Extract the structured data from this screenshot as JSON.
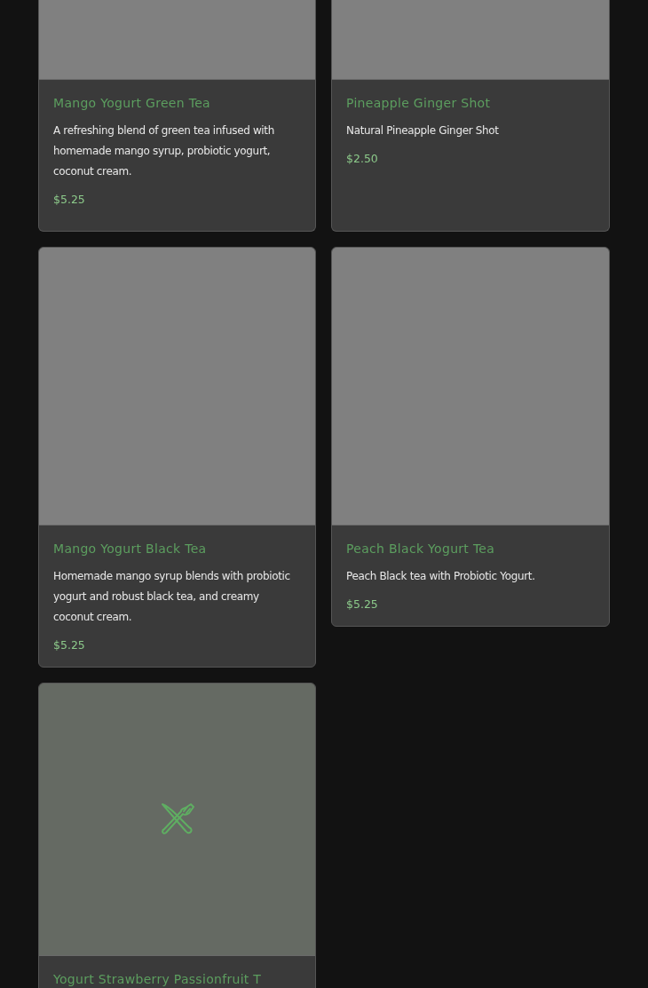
{
  "products": [
    {
      "kind": "photo",
      "name": "Mango Yogurt Green Tea",
      "description": "A refreshing blend of green tea infused with homemade mango syrup, probiotic yogurt, coconut cream.",
      "price": "$5.25"
    },
    {
      "kind": "photo",
      "name": "Pineapple Ginger Shot",
      "description": "Natural Pineapple Ginger Shot",
      "price": "$2.50"
    },
    {
      "kind": "photo",
      "name": "Mango Yogurt Black Tea",
      "description": "Homemade mango syrup blends with probiotic yogurt and robust black tea, and creamy coconut cream.",
      "price": "$5.25"
    },
    {
      "kind": "photo",
      "name": "Peach Black Yogurt Tea",
      "description": "Peach Black tea with Probiotic Yogurt.",
      "price": "$5.25"
    },
    {
      "kind": "placeholder",
      "name": "Yogurt Strawberry Passionfruit T"
    }
  ]
}
